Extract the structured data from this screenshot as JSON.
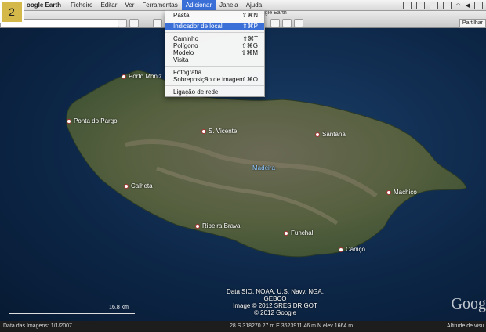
{
  "badge": "2",
  "menubar": {
    "app_name": "oogle Earth",
    "items": [
      "Ficheiro",
      "Editar",
      "Ver",
      "Ferramentas",
      "Adicionar",
      "Janela",
      "Ajuda"
    ],
    "active": "Adicionar"
  },
  "window_title": "oogle Earth",
  "toolbar": {
    "share_label": "Partilhar"
  },
  "dropdown": {
    "items": [
      {
        "label": "Pasta",
        "shortcut": "⇧⌘N"
      },
      {
        "label": "Indicador de local",
        "shortcut": "⇧⌘P",
        "highlighted": true
      },
      {
        "label": "Caminho",
        "shortcut": "⇧⌘T"
      },
      {
        "label": "Polígono",
        "shortcut": "⇧⌘G"
      },
      {
        "label": "Modelo",
        "shortcut": "⇧⌘M"
      },
      {
        "label": "Visita",
        "shortcut": ""
      },
      {
        "label": "Fotografia",
        "shortcut": ""
      },
      {
        "label": "Sobreposição de imagem",
        "shortcut": "⇧⌘O"
      },
      {
        "label": "Ligação de rede",
        "shortcut": ""
      }
    ]
  },
  "map": {
    "places": [
      "Porto Moniz",
      "Ponta do Pargo",
      "S. Vicente",
      "Santana",
      "Madeira",
      "Calheta",
      "Machico",
      "Ribeira Brava",
      "Funchal",
      "Caniço"
    ],
    "credits": [
      "Data SIO, NOAA, U.S. Navy, NGA, GEBCO",
      "Image © 2012 SRES DRIGOT",
      "© 2012 Google"
    ],
    "scale_label": "16.8 km",
    "google_mark": "Goog"
  },
  "status": {
    "date": "Data das Imagens: 1/1/2007",
    "coords": "28 S 318270.27 m E 3623911.46 m N elev  1664 m",
    "altitude": "Altitude de visu"
  }
}
